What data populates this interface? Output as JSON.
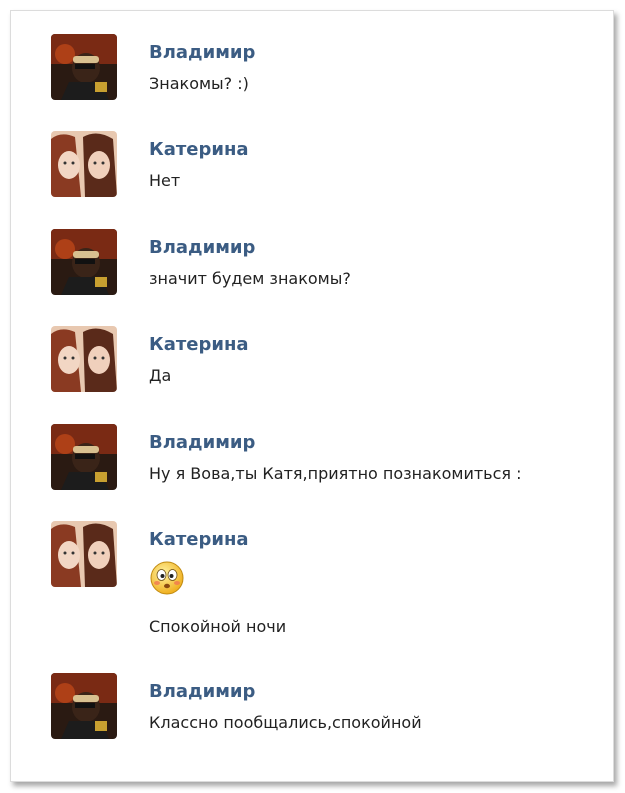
{
  "messages": [
    {
      "author": "Владимир",
      "avatar": "vladimir-avatar",
      "lines": [
        "Знакомы? :)"
      ]
    },
    {
      "author": "Катерина",
      "avatar": "katerina-avatar",
      "lines": [
        "Нет"
      ]
    },
    {
      "author": "Владимир",
      "avatar": "vladimir-avatar",
      "lines": [
        "значит будем знакомы?"
      ]
    },
    {
      "author": "Катерина",
      "avatar": "katerina-avatar",
      "lines": [
        "Да"
      ]
    },
    {
      "author": "Владимир",
      "avatar": "vladimir-avatar",
      "lines": [
        "Ну я Вова,ты Катя,приятно познакомиться :"
      ]
    },
    {
      "author": "Катерина",
      "avatar": "katerina-avatar",
      "emoji": "blushing-smiley-icon",
      "lines": [
        "Спокойной ночи"
      ]
    },
    {
      "author": "Владимир",
      "avatar": "vladimir-avatar",
      "lines": [
        "Классно пообщались,спокойной"
      ]
    }
  ],
  "colors": {
    "author_name": "#3b5c83",
    "message_text": "#222222"
  }
}
